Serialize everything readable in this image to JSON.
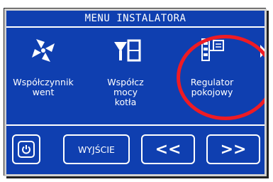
{
  "header": {
    "title": "MENU  INSTALATORA"
  },
  "tiles": [
    {
      "label": "Współczynnik\nwent",
      "icon": "fan-icon"
    },
    {
      "label": "Współcz\nmocy\nkotła",
      "icon": "boiler-power-icon"
    },
    {
      "label": "Regulator\npokojowy",
      "icon": "room-regulator-icon"
    }
  ],
  "footer": {
    "power_icon": "power-icon",
    "exit_label": "WYJŚCIE",
    "prev_label": "<<",
    "next_label": ">>"
  },
  "colors": {
    "screen_bg": "#0f3fb0",
    "foreground": "#ffffff",
    "highlight_ring": "#ee1b24"
  }
}
